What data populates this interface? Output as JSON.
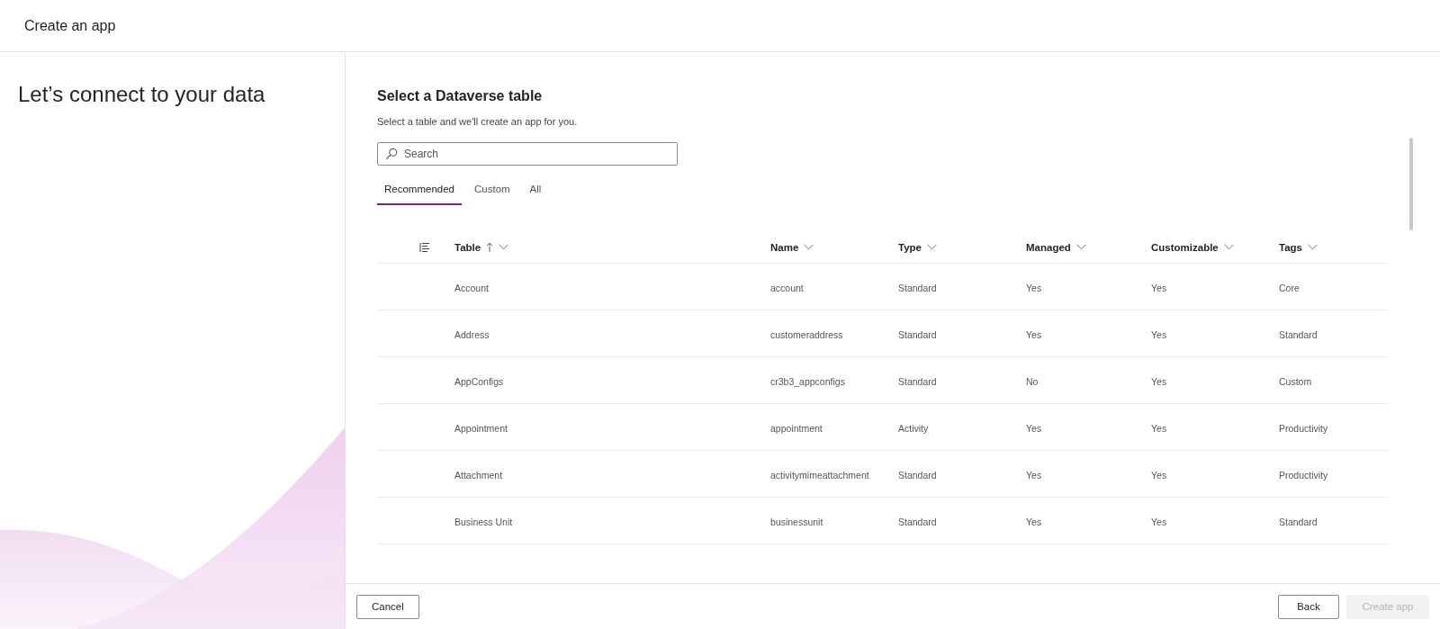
{
  "window": {
    "title": "Create an app"
  },
  "sidebar": {
    "heading": "Let’s connect to your data"
  },
  "main": {
    "heading": "Select a Dataverse table",
    "description": "Select a table and we'll create an app for you.",
    "search": {
      "placeholder": "Search"
    },
    "tabs": [
      {
        "label": "Recommended",
        "selected": true
      },
      {
        "label": "Custom",
        "selected": false
      },
      {
        "label": "All",
        "selected": false
      }
    ],
    "table": {
      "columns": [
        {
          "label": "Table",
          "sorted_ascending": true
        },
        {
          "label": "Name",
          "sorted_ascending": false
        },
        {
          "label": "Type",
          "sorted_ascending": false
        },
        {
          "label": "Managed",
          "sorted_ascending": false
        },
        {
          "label": "Customizable",
          "sorted_ascending": false
        },
        {
          "label": "Tags",
          "sorted_ascending": false
        }
      ],
      "rows": [
        [
          "Account",
          "account",
          "Standard",
          "Yes",
          "Yes",
          "Core"
        ],
        [
          "Address",
          "customeraddress",
          "Standard",
          "Yes",
          "Yes",
          "Standard"
        ],
        [
          "AppConfigs",
          "cr3b3_appconfigs",
          "Standard",
          "No",
          "Yes",
          "Custom"
        ],
        [
          "Appointment",
          "appointment",
          "Activity",
          "Yes",
          "Yes",
          "Productivity"
        ],
        [
          "Attachment",
          "activitymimeattachment",
          "Standard",
          "Yes",
          "Yes",
          "Productivity"
        ],
        [
          "Business Unit",
          "businessunit",
          "Standard",
          "Yes",
          "Yes",
          "Standard"
        ]
      ]
    }
  },
  "footer": {
    "left": [
      {
        "label": "Cancel",
        "disabled": false
      }
    ],
    "right": [
      {
        "label": "Back",
        "disabled": false
      },
      {
        "label": "Create app",
        "disabled": true
      }
    ]
  }
}
